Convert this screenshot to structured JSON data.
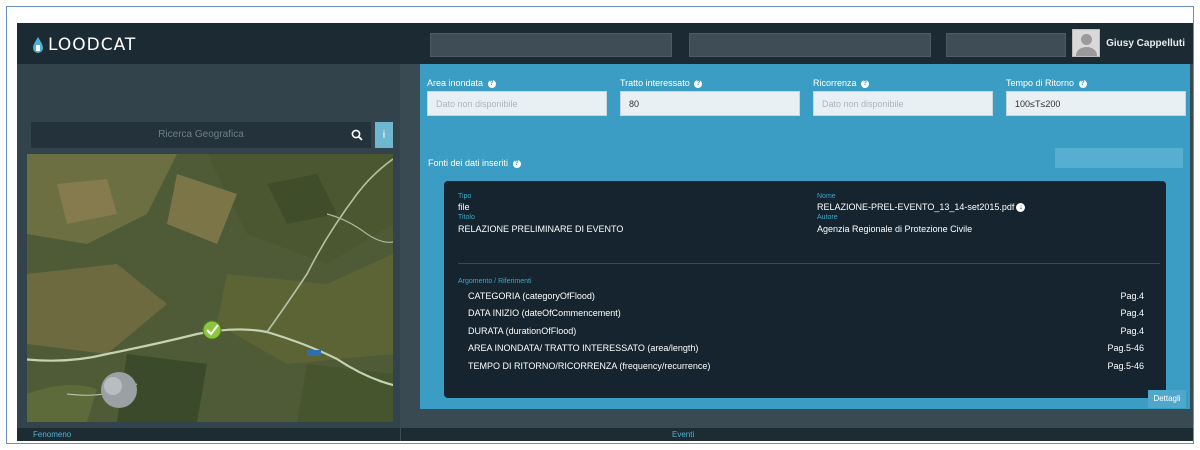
{
  "app": {
    "brand": "LOODCAT"
  },
  "header": {
    "field1": "",
    "field2": "",
    "field3": "",
    "user_name": "Giusy Cappelluti",
    "user_role": ""
  },
  "left": {
    "search_placeholder": "Ricerca Geografica",
    "info_button": "i",
    "map_badge": ""
  },
  "fields": [
    {
      "label": "Area inondata",
      "value": "Dato non disponibile",
      "placeholder": true
    },
    {
      "label": "Tratto interessato",
      "value": "80",
      "placeholder": false
    },
    {
      "label": "Ricorrenza",
      "value": "Dato non disponibile",
      "placeholder": true
    },
    {
      "label": "Tempo di Ritorno",
      "value": "100≤T≤200",
      "placeholder": false
    }
  ],
  "sources_label": "Fonti dei dati inseriti",
  "source": {
    "tipo_label": "Tipo",
    "tipo_value": "file",
    "nome_label": "Nome",
    "nome_value": "RELAZIONE-PREL-EVENTO_13_14-set2015.pdf",
    "titolo_label": "Titolo",
    "titolo_value": "RELAZIONE PRELIMINARE DI EVENTO",
    "autore_label": "Autore",
    "autore_value": "Agenzia Regionale di Protezione Civile",
    "section_label": "Argomento / Riferimenti",
    "rows": [
      {
        "text": "CATEGORIA (categoryOfFlood)",
        "page": "Pag.4"
      },
      {
        "text": "DATA INIZIO (dateOfCommencement)",
        "page": "Pag.4"
      },
      {
        "text": "DURATA (durationOfFlood)",
        "page": "Pag.4"
      },
      {
        "text": "AREA INONDATA/ TRATTO INTERESSATO (area/length)",
        "page": "Pag.5-46"
      },
      {
        "text": "TEMPO DI RITORNO/RICORRENZA (frequency/recurrence)",
        "page": "Pag.5-46"
      }
    ]
  },
  "buttons": {
    "dettagli": "Dettagli"
  },
  "footer": {
    "left": "Fenomeno",
    "center": "Eventi"
  },
  "colors": {
    "accent": "#3c9dc4",
    "header": "#1b2a33",
    "card": "#15242e"
  }
}
